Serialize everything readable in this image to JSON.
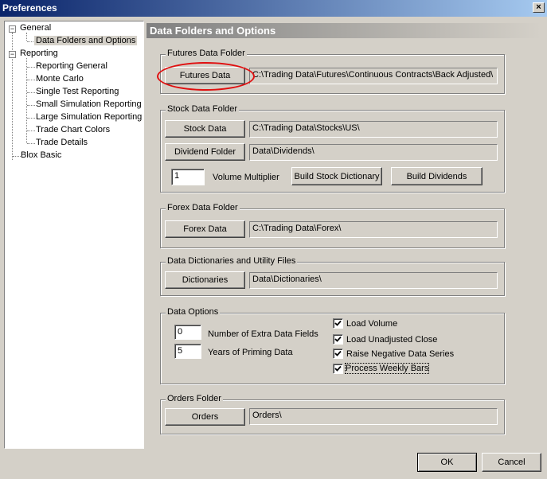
{
  "window": {
    "title": "Preferences",
    "close_glyph": "×"
  },
  "tree": {
    "general": "General",
    "data_folders": "Data Folders and Options",
    "reporting": "Reporting",
    "reporting_general": "Reporting General",
    "monte_carlo": "Monte Carlo",
    "single_test": "Single Test Reporting",
    "small_sim": "Small Simulation Reporting",
    "large_sim": "Large Simulation Reporting",
    "trade_chart": "Trade Chart Colors",
    "trade_details": "Trade Details",
    "blox_basic": "Blox Basic",
    "expander_glyph": "−"
  },
  "panel": {
    "title": "Data Folders and Options"
  },
  "futures": {
    "group": "Futures Data Folder",
    "button": "Futures Data",
    "path": "C:\\Trading Data\\Futures\\Continuous Contracts\\Back Adjusted\\"
  },
  "stock": {
    "group": "Stock Data Folder",
    "stock_button": "Stock Data",
    "stock_path": "C:\\Trading Data\\Stocks\\US\\",
    "dividend_button": "Dividend Folder",
    "dividend_path": "Data\\Dividends\\",
    "volume_multiplier_value": "1",
    "volume_multiplier_label": "Volume Multiplier",
    "build_stock_dict": "Build Stock Dictionary",
    "build_dividends": "Build Dividends"
  },
  "forex": {
    "group": "Forex Data Folder",
    "button": "Forex Data",
    "path": "C:\\Trading Data\\Forex\\"
  },
  "dictionaries": {
    "group": "Data Dictionaries and Utility Files",
    "button": "Dictionaries",
    "path": "Data\\Dictionaries\\"
  },
  "options": {
    "group": "Data Options",
    "extra_fields_value": "0",
    "extra_fields_label": "Number of Extra Data Fields",
    "priming_value": "5",
    "priming_label": "Years of Priming Data",
    "load_volume": "Load Volume",
    "load_unadjusted": "Load Unadjusted Close",
    "raise_negative": "Raise Negative Data Series",
    "process_weekly": "Process Weekly Bars"
  },
  "orders": {
    "group": "Orders Folder",
    "button": "Orders",
    "path": "Orders\\"
  },
  "footer": {
    "ok": "OK",
    "cancel": "Cancel"
  },
  "colors": {
    "highlight_ellipse": "#e01010",
    "title_gradient_start": "#0a246a"
  }
}
